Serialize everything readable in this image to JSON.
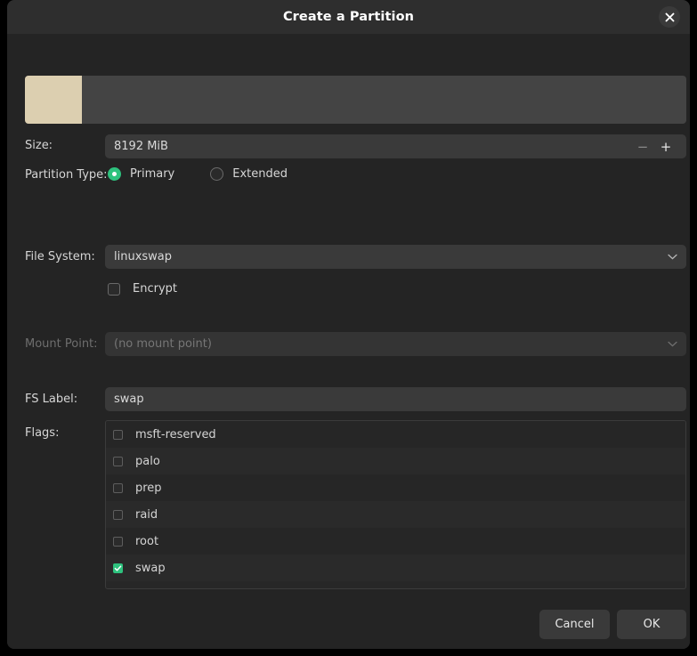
{
  "window": {
    "title": "Create a Partition",
    "close_icon": "close-icon"
  },
  "preview": {
    "used_color": "#dccfb0",
    "free_color": "#444444"
  },
  "fields": {
    "size": {
      "label": "Size:",
      "value": "8192 MiB",
      "decrement": "−",
      "increment": "+"
    },
    "partition_type": {
      "label": "Partition Type:",
      "options": [
        {
          "label": "Primary",
          "selected": true
        },
        {
          "label": "Extended",
          "selected": false
        }
      ]
    },
    "file_system": {
      "label": "File System:",
      "value": "linuxswap",
      "chevron": "⌄"
    },
    "encrypt": {
      "label": "Encrypt",
      "checked": false
    },
    "mount_point": {
      "label": "Mount Point:",
      "value": "(no mount point)",
      "chevron": "⌄",
      "disabled": true
    },
    "fs_label": {
      "label": "FS Label:",
      "value": "swap"
    },
    "flags": {
      "label": "Flags:",
      "items": [
        {
          "label": "msft-reserved",
          "checked": false
        },
        {
          "label": "palo",
          "checked": false
        },
        {
          "label": "prep",
          "checked": false
        },
        {
          "label": "raid",
          "checked": false
        },
        {
          "label": "root",
          "checked": false
        },
        {
          "label": "swap",
          "checked": true
        }
      ]
    }
  },
  "footer": {
    "cancel_label": "Cancel",
    "ok_label": "OK"
  },
  "colors": {
    "accent": "#2ec27e",
    "dialog_bg": "#242424",
    "titlebar_bg": "#2e2e2e",
    "field_bg": "#3a3a3a"
  }
}
